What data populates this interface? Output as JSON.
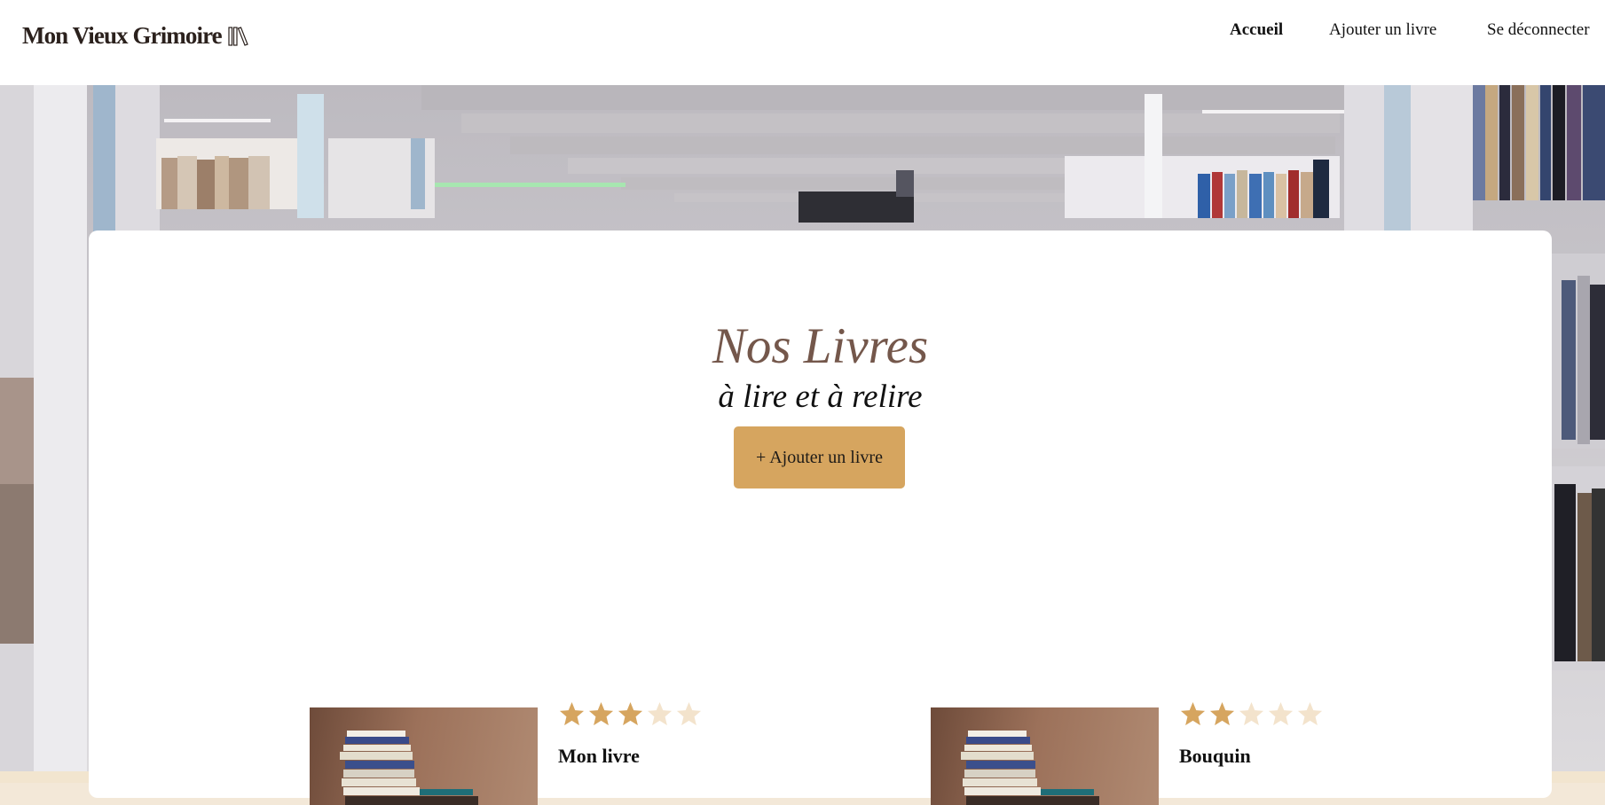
{
  "brand": {
    "name": "Mon Vieux Grimoire",
    "icon": "book-stack-logo-icon"
  },
  "nav": {
    "home": "Accueil",
    "add_book": "Ajouter un livre",
    "logout": "Se déconnecter"
  },
  "hero": {
    "title": "Nos Livres",
    "subtitle": "à lire et à relire",
    "add_button": "+ Ajouter un livre"
  },
  "books": [
    {
      "title": "Mon livre",
      "rating": 3,
      "max_rating": 5
    },
    {
      "title": "Bouquin",
      "rating": 2,
      "max_rating": 5
    }
  ],
  "colors": {
    "accent": "#d6a55f",
    "title": "#74574b",
    "star_empty": "#f3e3cc"
  }
}
